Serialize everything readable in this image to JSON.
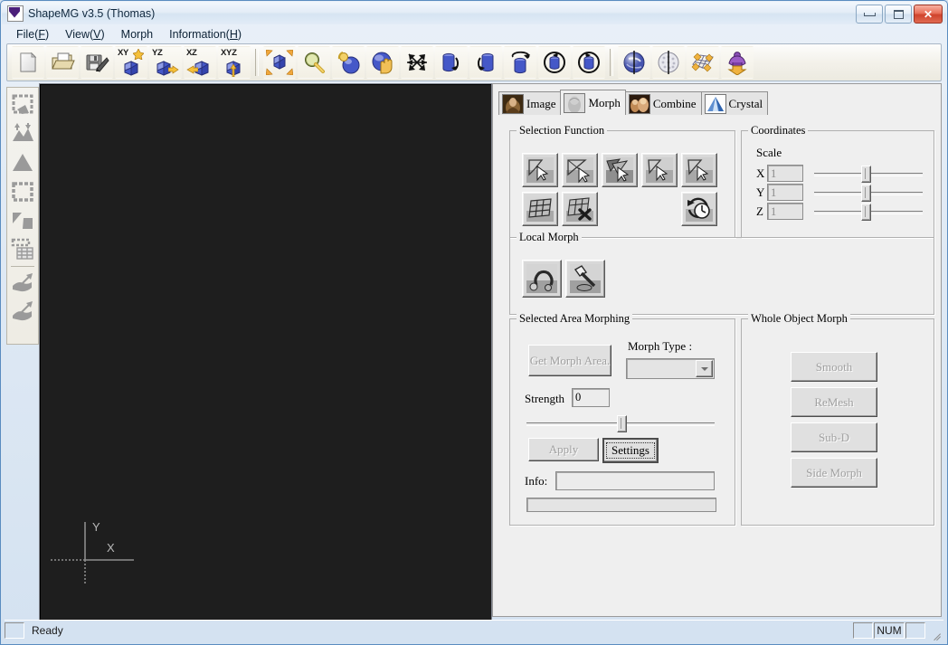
{
  "window": {
    "title": "ShapeMG v3.5 (Thomas)",
    "app_icon": "shapemg-logo-icon",
    "controls": {
      "minimize": "minimize-button",
      "maximize": "maximize-button",
      "close": "close-button",
      "close_glyph": "✕"
    }
  },
  "menubar": {
    "items": [
      {
        "text": "File(F)",
        "pre": "File(",
        "key": "F",
        "post": ")"
      },
      {
        "text": "View(V)",
        "pre": "View(",
        "key": "V",
        "post": ")"
      },
      {
        "text": "Morph",
        "pre": "Morph",
        "key": "",
        "post": ""
      },
      {
        "text": "Information(H)",
        "pre": "Information(",
        "key": "H",
        "post": ")"
      }
    ]
  },
  "toolbar": {
    "buttons": [
      {
        "name": "new-file-icon",
        "label": ""
      },
      {
        "name": "open-folder-icon",
        "label": ""
      },
      {
        "name": "save-disk-icon",
        "label": ""
      },
      {
        "name": "view-xy-plane-icon",
        "label": "XY"
      },
      {
        "name": "view-yz-plane-icon",
        "label": "YZ"
      },
      {
        "name": "view-xz-plane-icon",
        "label": "XZ"
      },
      {
        "name": "view-xyz-iso-icon",
        "label": "XYZ"
      },
      {
        "name": "fit-to-window-icon",
        "label": ""
      },
      {
        "name": "zoom-icon",
        "label": ""
      },
      {
        "name": "zoom-object-icon",
        "label": ""
      },
      {
        "name": "pan-hand-icon",
        "label": ""
      },
      {
        "name": "free-rotate-icon",
        "label": ""
      },
      {
        "name": "rotate-left-icon",
        "label": ""
      },
      {
        "name": "rotate-right-icon",
        "label": ""
      },
      {
        "name": "rotate-top-ccw-icon",
        "label": ""
      },
      {
        "name": "rotate-cylinder-ccw-icon",
        "label": ""
      },
      {
        "name": "rotate-cylinder-cw-icon",
        "label": ""
      },
      {
        "name": "shade-smooth-icon",
        "label": ""
      },
      {
        "name": "shade-points-icon",
        "label": ""
      },
      {
        "name": "wireframe-grid-icon",
        "label": ""
      },
      {
        "name": "export-object-icon",
        "label": ""
      }
    ],
    "separators_after": [
      6,
      16
    ]
  },
  "leftbar": {
    "buttons": [
      {
        "name": "select-region-icon"
      },
      {
        "name": "elevate-terrain-icon"
      },
      {
        "name": "triangle-shape-icon"
      },
      {
        "name": "select-all-region-icon"
      },
      {
        "name": "split-region-icon"
      },
      {
        "name": "mesh-grid-icon"
      },
      {
        "name": "paint-fill-icon"
      },
      {
        "name": "paint-erase-icon"
      }
    ],
    "separators_after": [
      5
    ]
  },
  "viewport": {
    "name": "3d-viewport",
    "background_color": "#1e1e1e",
    "axis_labels": {
      "x": "X",
      "y": "Y"
    }
  },
  "tabs": [
    {
      "label": "Image",
      "icon": "image-thumbnail-icon",
      "active": false
    },
    {
      "label": "Morph",
      "icon": "morph-thumbnail-icon",
      "active": true
    },
    {
      "label": "Combine",
      "icon": "combine-thumbnail-icon",
      "active": false
    },
    {
      "label": "Crystal",
      "icon": "crystal-thumbnail-icon",
      "active": false
    }
  ],
  "selection_function": {
    "caption": "Selection Function",
    "row1": [
      {
        "name": "select-single-face-icon"
      },
      {
        "name": "select-edge-loop-icon"
      },
      {
        "name": "select-multi-face-icon"
      },
      {
        "name": "select-vertex-icon"
      },
      {
        "name": "select-paint-icon"
      }
    ],
    "row2": [
      {
        "name": "select-grid-icon"
      },
      {
        "name": "deselect-grid-icon"
      }
    ],
    "history": {
      "name": "selection-history-clock-icon"
    }
  },
  "coordinates": {
    "caption": "Coordinates",
    "scale_label": "Scale",
    "axes": [
      {
        "label": "X",
        "value": "1",
        "slider_pct": 46
      },
      {
        "label": "Y",
        "value": "1",
        "slider_pct": 46
      },
      {
        "label": "Z",
        "value": "1",
        "slider_pct": 46
      }
    ]
  },
  "local_morph": {
    "caption": "Local Morph",
    "buttons": [
      {
        "name": "magnet-morph-icon"
      },
      {
        "name": "hammer-morph-icon"
      }
    ]
  },
  "selected_area_morphing": {
    "caption": "Selected Area Morphing",
    "get_morph_area_label": "Get Morph Area.",
    "morph_type_label": "Morph Type :",
    "morph_type_value": "",
    "strength_label": "Strength",
    "strength_value": "0",
    "strength_slider_pct": 50,
    "apply_label": "Apply",
    "settings_label": "Settings",
    "info_label": "Info:",
    "info_value": "",
    "progress_value": ""
  },
  "whole_object_morph": {
    "caption": "Whole Object Morph",
    "buttons": [
      {
        "label": "Smooth"
      },
      {
        "label": "ReMesh"
      },
      {
        "label": "Sub-D"
      },
      {
        "label": "Side Morph"
      }
    ]
  },
  "statusbar": {
    "message": "Ready",
    "panes": [
      "",
      "NUM",
      ""
    ]
  }
}
